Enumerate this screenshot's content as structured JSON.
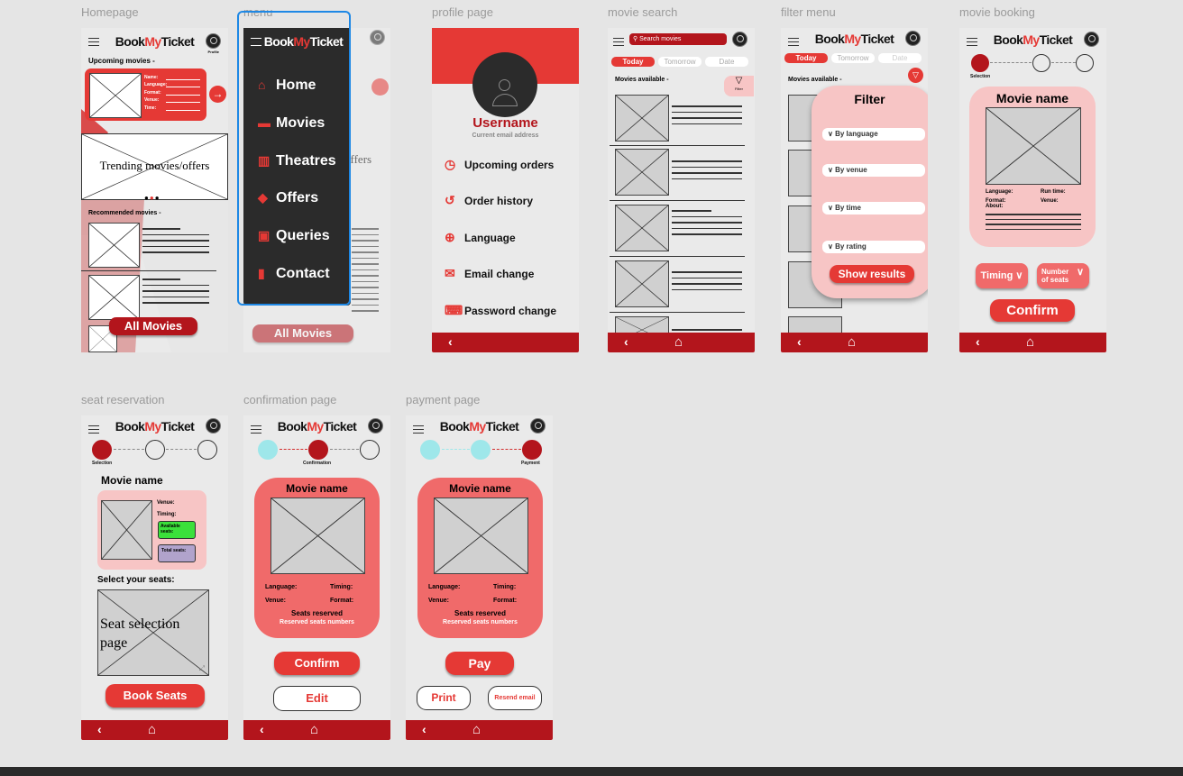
{
  "app": {
    "logo_a": "Book",
    "logo_b": "My",
    "logo_c": "Ticket"
  },
  "labels": {
    "homepage": "Homepage",
    "menu": "menu",
    "profile": "profile page",
    "search": "movie search",
    "filter": "filter menu",
    "booking": "movie booking",
    "seat": "seat reservation",
    "confirmation": "confirmation page",
    "payment": "payment page"
  },
  "homepage": {
    "profile_caption": "Profile",
    "upcoming": "Upcoming movies -",
    "fields": [
      "Name:",
      "Language:",
      "Format:",
      "Venue:",
      "Time:"
    ],
    "trending": "Trending movies/offers",
    "recommended": "Recommended movies -",
    "all_movies": "All Movies"
  },
  "menu": {
    "items": [
      {
        "icon": "home-icon",
        "glyph": "⌂",
        "label": "Home"
      },
      {
        "icon": "clapper-icon",
        "glyph": "▬",
        "label": "Movies"
      },
      {
        "icon": "building-icon",
        "glyph": "▥",
        "label": "Theatres"
      },
      {
        "icon": "tag-icon",
        "glyph": "◆",
        "label": "Offers"
      },
      {
        "icon": "question-icon",
        "glyph": "▣",
        "label": "Queries"
      },
      {
        "icon": "contact-icon",
        "glyph": "▮",
        "label": "Contact"
      }
    ],
    "bg_text": "offers",
    "bg_button": "All Movies"
  },
  "profile": {
    "username": "Username",
    "email": "Current email address",
    "items": [
      {
        "icon": "clock-icon",
        "glyph": "◷",
        "label": "Upcoming orders"
      },
      {
        "icon": "history-icon",
        "glyph": "↺",
        "label": "Order history"
      },
      {
        "icon": "globe-icon",
        "glyph": "⊕",
        "label": "Language"
      },
      {
        "icon": "mail-icon",
        "glyph": "✉",
        "label": "Email change"
      },
      {
        "icon": "password-icon",
        "glyph": "⌨",
        "label": "Password change"
      }
    ]
  },
  "search": {
    "placeholder": "Search movies",
    "tabs": [
      "Today",
      "Tomorrow",
      "Date"
    ],
    "available": "Movies available -",
    "filter": "Filter"
  },
  "filter": {
    "available": "Movies available -",
    "title": "Filter",
    "options": [
      "By language",
      "By venue",
      "By time",
      "By rating"
    ],
    "show": "Show results"
  },
  "booking": {
    "step": "Selection",
    "movie": "Movie name",
    "lang": "Language:",
    "run": "Run time:",
    "format": "Format:",
    "venue": "Venue:",
    "about": "About:",
    "timing": "Timing",
    "seats_a": "Number",
    "seats_b": "of seats",
    "confirm": "Confirm"
  },
  "seat": {
    "step": "Selection",
    "movie": "Movie name",
    "venue": "Venue:",
    "timing": "Timing:",
    "available": "Available seats:",
    "total": "Total seats:",
    "select": "Select your seats:",
    "seatpage": "Seat selection page",
    "book": "Book Seats"
  },
  "confirmation": {
    "step": "Confirmation",
    "movie": "Movie name",
    "lang": "Language:",
    "timing": "Timing:",
    "venue": "Venue:",
    "format": "Format:",
    "reserved": "Seats reserved",
    "numbers": "Reserved seats numbers",
    "confirm": "Confirm",
    "edit": "Edit"
  },
  "payment": {
    "step": "Payment",
    "movie": "Movie name",
    "lang": "Language:",
    "timing": "Timing:",
    "venue": "Venue:",
    "format": "Format:",
    "reserved": "Seats reserved",
    "numbers": "Reserved seats numbers",
    "pay": "Pay",
    "print": "Print",
    "resend": "Resend email"
  },
  "colors": {
    "brand_red": "#e53935",
    "dark_red": "#b3151c",
    "pink": "#f7c5c5",
    "salmon": "#f06a6a",
    "green": "#3be03b",
    "purple": "#b1a3cc",
    "cyan": "#9ee7ea",
    "selection": "#1e88e5"
  }
}
